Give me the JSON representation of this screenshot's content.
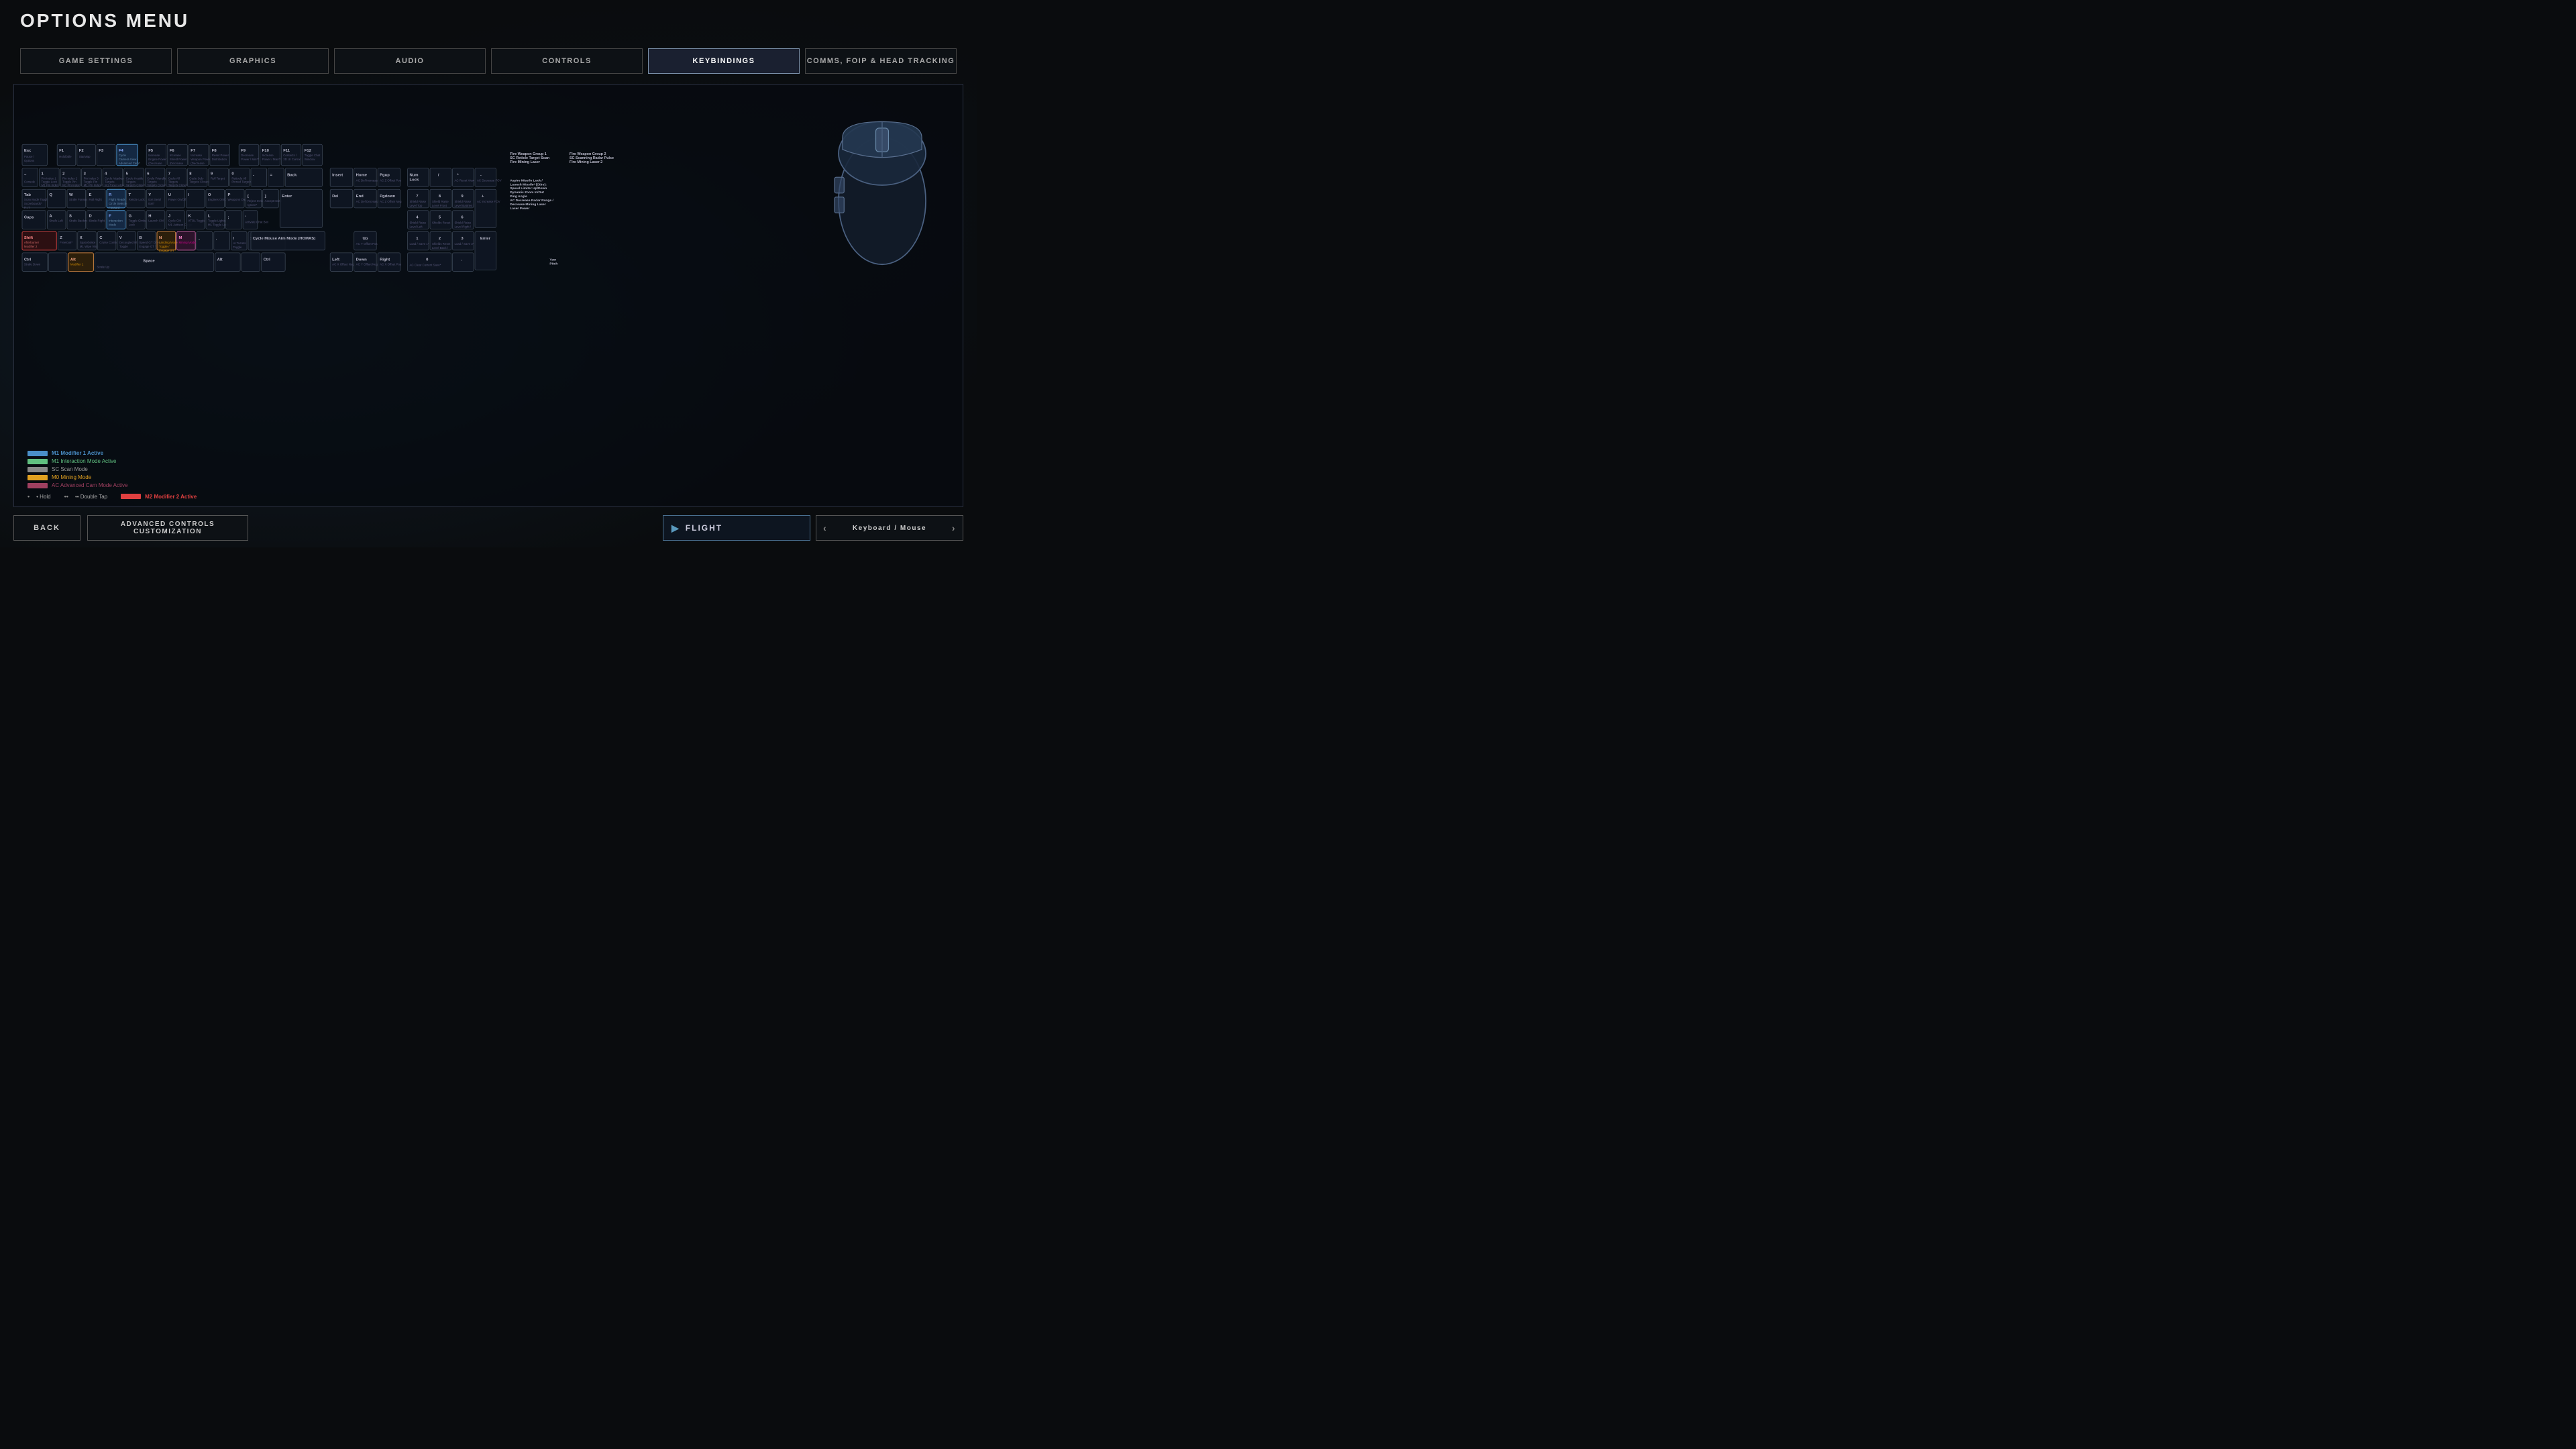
{
  "title": "OPTIONS MENU",
  "nav": {
    "tabs": [
      {
        "label": "GAME SETTINGS",
        "active": false
      },
      {
        "label": "GRAPHICS",
        "active": false
      },
      {
        "label": "AUDIO",
        "active": false
      },
      {
        "label": "CONTROLS",
        "active": false
      },
      {
        "label": "KEYBINDINGS",
        "active": true
      },
      {
        "label": "COMMS, FOIP & HEAD TRACKING",
        "active": false
      }
    ]
  },
  "bottom": {
    "back_label": "BACK",
    "advanced_label": "ADVANCED CONTROLS CUSTOMIZATION",
    "flight_label": "FLIGHT",
    "keyboard_mouse_label": "Keyboard / Mouse"
  },
  "legend": {
    "m1": "M1  Modifier 1 Active",
    "m1_color": "#4a8fc8",
    "m1sub": "M1  Interaction Mode Active",
    "m1sub_color": "#60c080",
    "sc": "SC  Scan Mode",
    "sc_color": "#888",
    "m0": "M0  Mining Mode",
    "m0_color": "#e0a020",
    "ac": "AC  Advanced Cam Mode Active",
    "ac_color": "#a04060",
    "hold": "•  Hold",
    "double_tap": "••  Double Tap",
    "m2": "M2  Modifier 2 Active",
    "m2_color": "#e04040"
  }
}
